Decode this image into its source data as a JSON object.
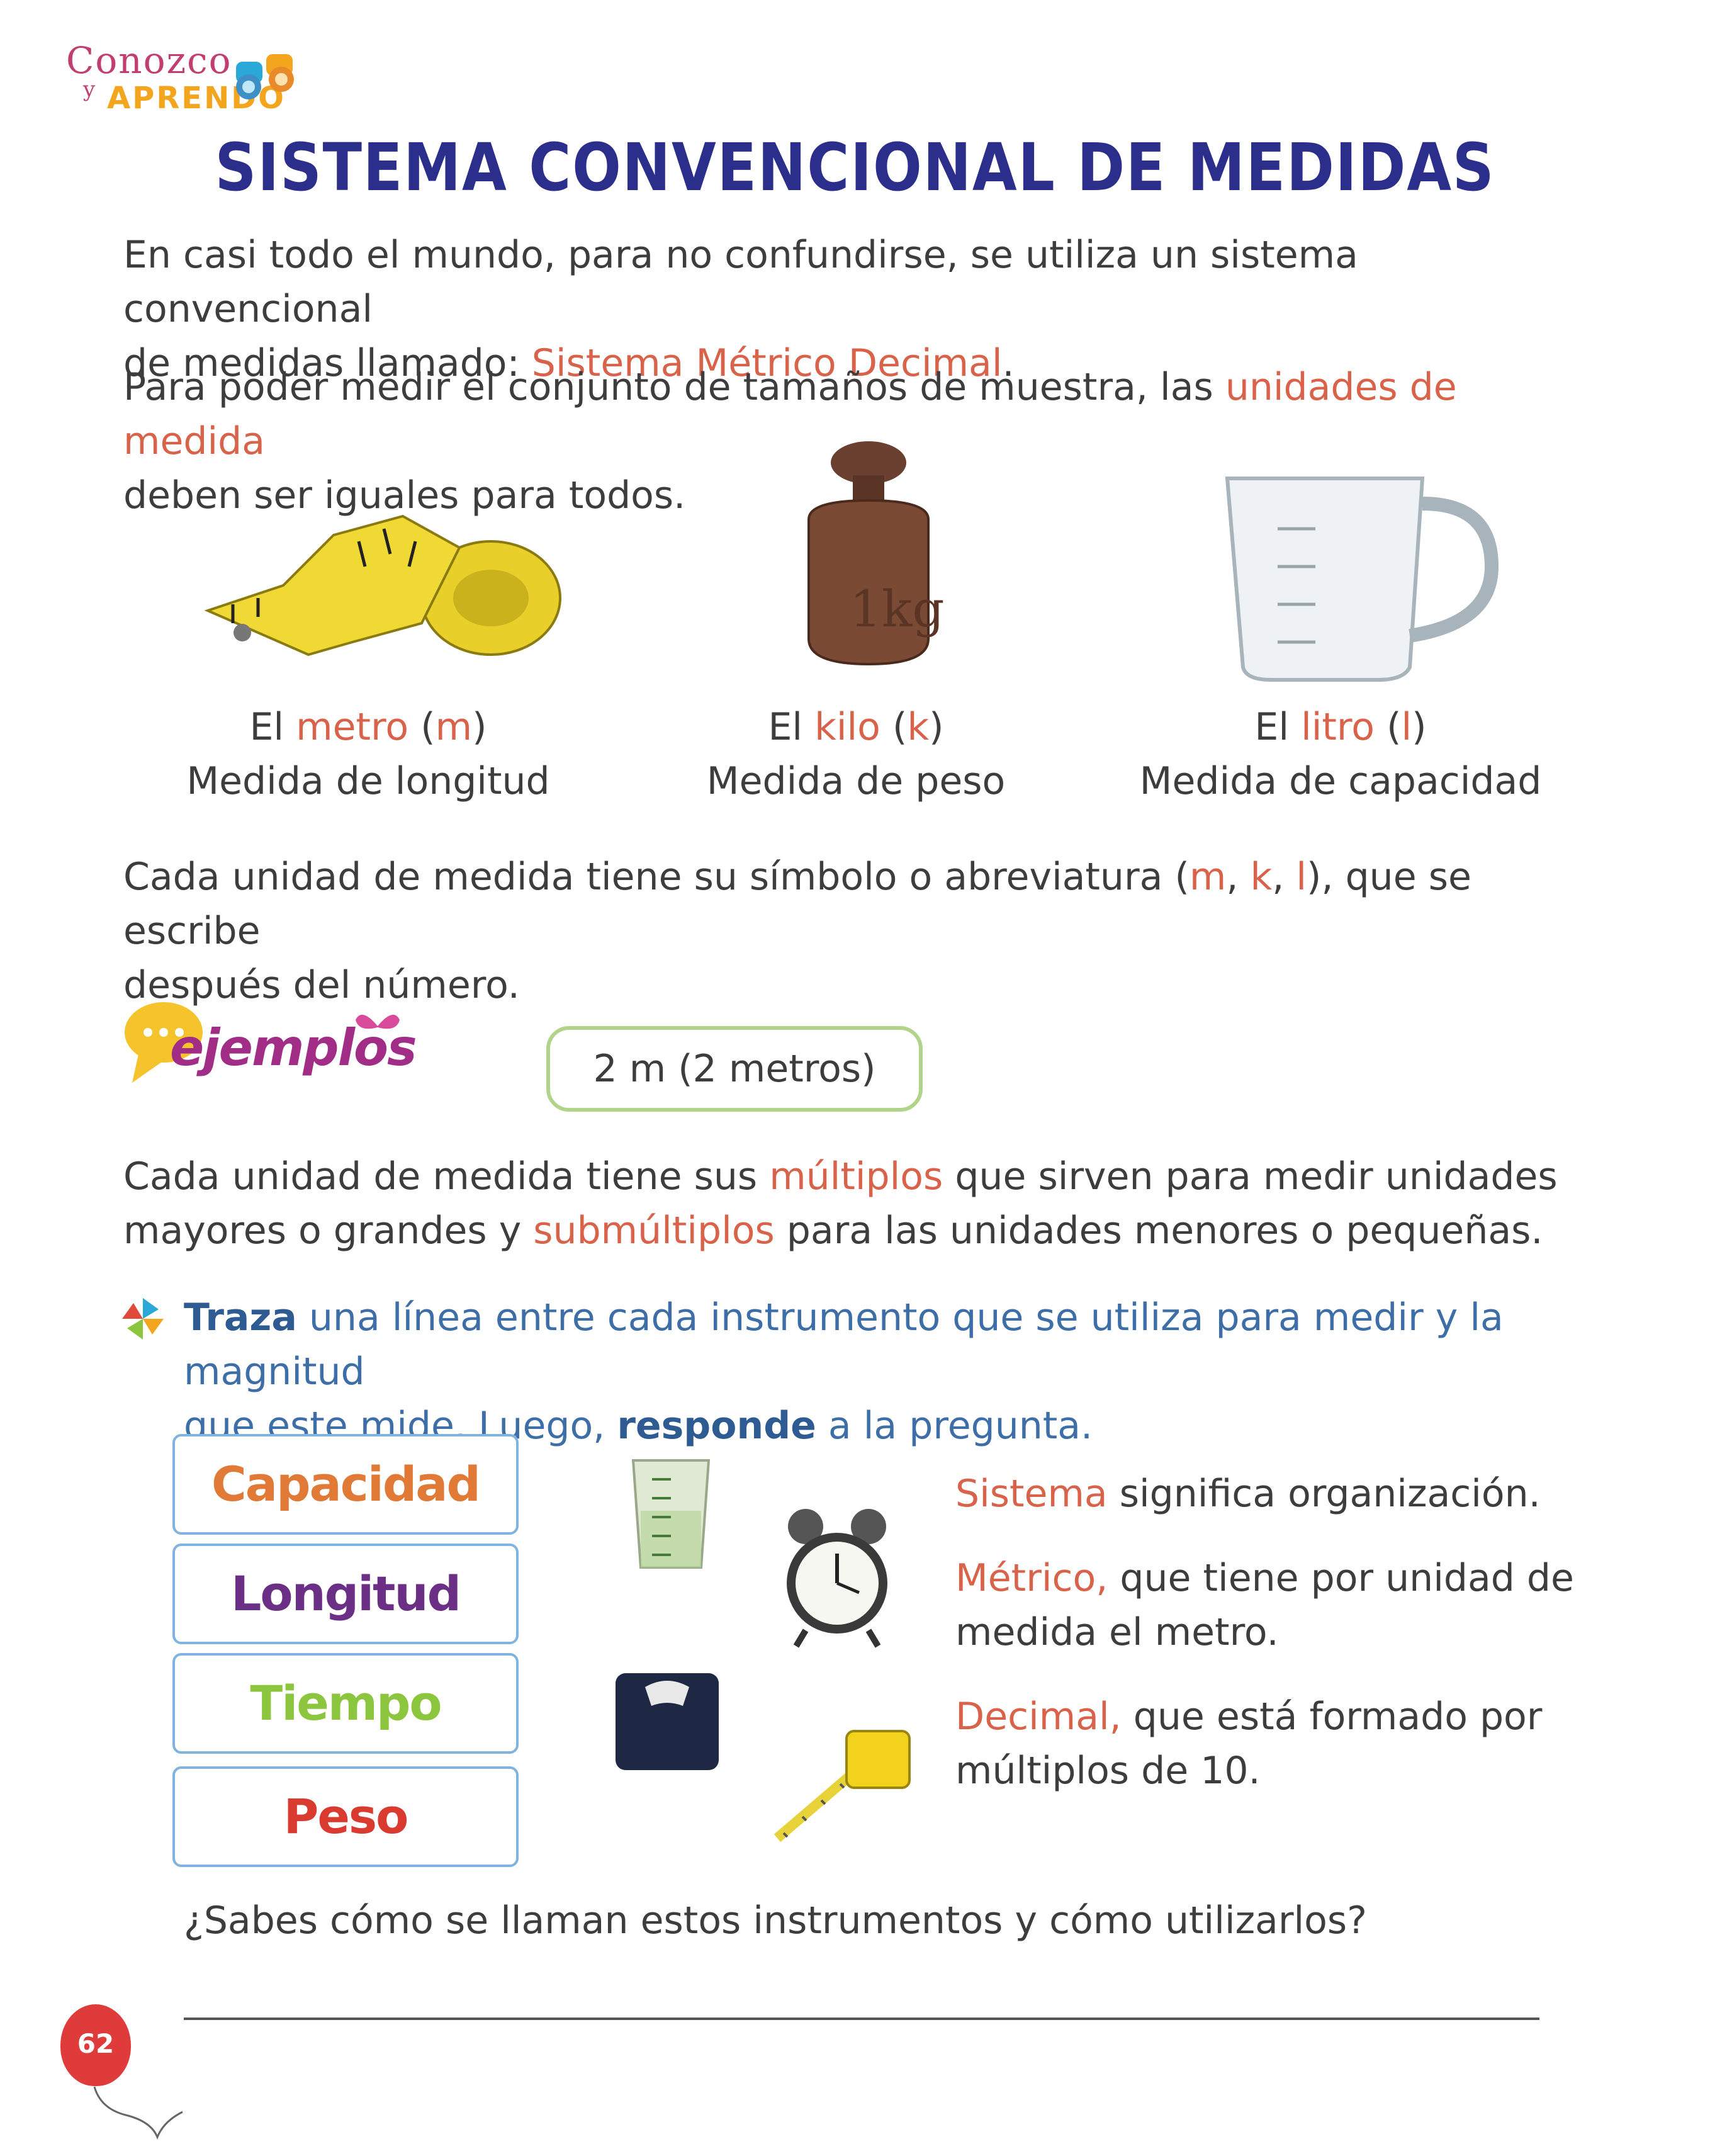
{
  "logo": {
    "line1": "Conozco",
    "y": "y",
    "line2": "APRENDO"
  },
  "title": "SISTEMA CONVENCIONAL DE MEDIDAS",
  "intro": {
    "p1_a": "En casi todo el mundo, para no confundirse, se utiliza un sistema convencional",
    "p1_b": "de medidas llamado: ",
    "p1_highlight": "Sistema Métrico Decimal",
    "p1_end": ".",
    "p2_a": "Para poder medir el conjunto de tamaños de muestra, las ",
    "p2_highlight": "unidades de medida",
    "p2_b": "deben ser iguales para todos."
  },
  "units": [
    {
      "pre": "El ",
      "name": "metro",
      "open": " (",
      "symbol": "m",
      "close": ")",
      "desc": "Medida de longitud",
      "image": "tape-measure"
    },
    {
      "pre": "El ",
      "name": "kilo",
      "open": " (",
      "symbol": "k",
      "close": ")",
      "desc": "Medida de peso",
      "image": "kilogram-weight"
    },
    {
      "pre": "El ",
      "name": "litro",
      "open": " (",
      "symbol": "l",
      "close": ")",
      "desc": "Medida de capacidad",
      "image": "measuring-jug"
    }
  ],
  "symbols_text": {
    "a": "Cada unidad de medida tiene su símbolo o abreviatura (",
    "m": "m",
    "sep1": ", ",
    "k": "k",
    "sep2": ", ",
    "l": "l",
    "b": "), que se escribe",
    "c": "después del número."
  },
  "examples": {
    "logo": "ejemplos",
    "box": "2 m (2 metros)"
  },
  "multiples": {
    "a": "Cada unidad de medida tiene sus ",
    "multiples": "múltiplos",
    "b": " que sirven para medir unidades",
    "c": "mayores o grandes y ",
    "submultiples": "submúltiplos",
    "d": " para las unidades menores o pequeñas."
  },
  "activity": {
    "bold1": "Traza",
    "text1": " una línea entre cada instrumento que se utiliza para medir y la magnitud",
    "text2": "que este mide. Luego, ",
    "bold2": "responde",
    "text3": " a la pregunta."
  },
  "magnitudes": [
    {
      "label": "Capacidad",
      "color": "#e07a36"
    },
    {
      "label": "Longitud",
      "color": "#6b2f86"
    },
    {
      "label": "Tiempo",
      "color": "#8cc63f"
    },
    {
      "label": "Peso",
      "color": "#d93b31"
    }
  ],
  "instruments": [
    "measuring-cup-icon",
    "alarm-clock-icon",
    "bathroom-scale-icon",
    "tape-measure-icon"
  ],
  "definitions": [
    {
      "term": "Sistema",
      "rest1": " significa organización.",
      "rest2": ""
    },
    {
      "term": "Métrico,",
      "rest1": " que tiene por unidad de",
      "rest2": "medida el metro."
    },
    {
      "term": "Decimal,",
      "rest1": " que está formado por",
      "rest2": "múltiplos de 10."
    }
  ],
  "question": "¿Sabes cómo se llaman estos instrumentos y cómo utilizarlos?",
  "page_number": "62",
  "colors": {
    "title": "#2c2e8c",
    "highlight": "#d9634a",
    "instruction": "#3e6ea8",
    "box_border": "#7fb3e0"
  }
}
